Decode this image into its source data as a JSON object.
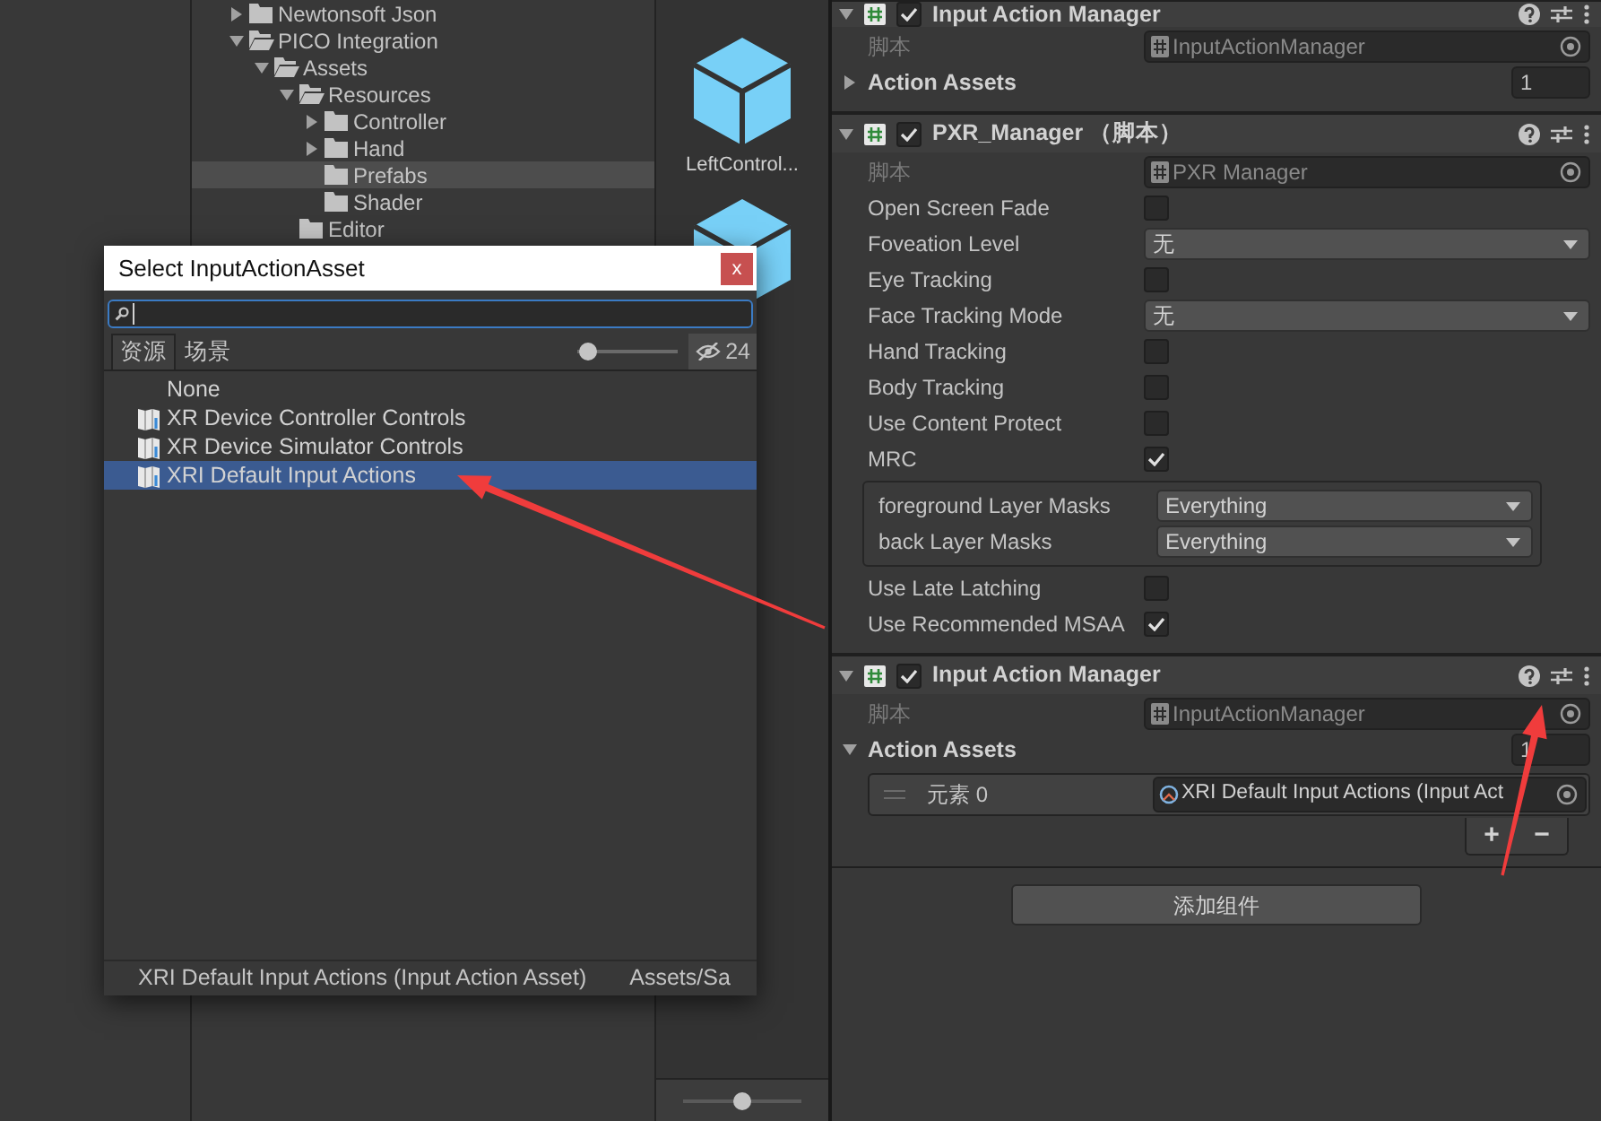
{
  "project_tree": [
    {
      "label": "Newtonsoft Json",
      "expanded": false,
      "selected": false
    },
    {
      "label": "PICO Integration",
      "expanded": true,
      "selected": false,
      "children": [
        {
          "label": "Assets",
          "expanded": true,
          "selected": false,
          "children": [
            {
              "label": "Resources",
              "expanded": true,
              "selected": false,
              "children": [
                {
                  "label": "Controller",
                  "expanded": false,
                  "selected": false
                },
                {
                  "label": "Hand",
                  "expanded": false,
                  "selected": false
                },
                {
                  "label": "Prefabs",
                  "selected": true
                },
                {
                  "label": "Shader",
                  "selected": false
                }
              ]
            },
            {
              "label": "Editor",
              "selected": false
            }
          ]
        }
      ]
    }
  ],
  "assets": [
    {
      "kind": "prefab",
      "label": "LeftControl..."
    },
    {
      "kind": "prefab"
    }
  ],
  "asset_zoom": {
    "level": 0.5
  },
  "picker": {
    "title": "Select InputActionAsset",
    "close": "x",
    "tabs": [
      {
        "label": "资源",
        "selected": true
      },
      {
        "label": "场景",
        "selected": false
      }
    ],
    "size_slider": {
      "level": 0.1
    },
    "hidden_count": "24",
    "items": [
      {
        "kind": "none",
        "label": "None",
        "selected": false
      },
      {
        "kind": "asset",
        "label": "XR Device Controller Controls",
        "selected": false
      },
      {
        "kind": "asset",
        "label": "XR Device Simulator Controls",
        "selected": false
      },
      {
        "kind": "asset",
        "label": "XRI Default Input Actions",
        "selected": true
      }
    ],
    "footer": {
      "name": "XRI Default Input Actions (Input Action Asset)",
      "path": "Assets/Sa"
    }
  },
  "inspector": {
    "components": [
      {
        "title": "Input Action Manager",
        "enabled": true,
        "expanded": true,
        "fields": [
          {
            "kind": "script",
            "label": "脚本",
            "value": "InputActionManager",
            "disabled": true
          },
          {
            "kind": "foldout",
            "label": "Action Assets",
            "expanded": false,
            "count": "1"
          }
        ]
      },
      {
        "title": "PXR_Manager （脚本）",
        "enabled": true,
        "expanded": true,
        "fields": [
          {
            "kind": "script",
            "label": "脚本",
            "value": "PXR Manager",
            "disabled": true
          },
          {
            "kind": "checkbox",
            "label": "Open Screen Fade",
            "checked": false
          },
          {
            "kind": "dropdown",
            "label": "Foveation Level",
            "value": "无"
          },
          {
            "kind": "checkbox",
            "label": "Eye Tracking",
            "checked": false
          },
          {
            "kind": "dropdown",
            "label": "Face Tracking Mode",
            "value": "无"
          },
          {
            "kind": "checkbox",
            "label": "Hand Tracking",
            "checked": false
          },
          {
            "kind": "checkbox",
            "label": "Body Tracking",
            "checked": false
          },
          {
            "kind": "checkbox",
            "label": "Use Content Protect",
            "checked": false
          },
          {
            "kind": "checkbox",
            "label": "MRC",
            "checked": true
          },
          {
            "kind": "group",
            "fields": [
              {
                "kind": "dropdown",
                "label": "foreground Layer Masks",
                "value": "Everything"
              },
              {
                "kind": "dropdown",
                "label": "back Layer Masks",
                "value": "Everything"
              }
            ]
          },
          {
            "kind": "checkbox",
            "label": "Use Late Latching",
            "checked": false
          },
          {
            "kind": "checkbox",
            "label": "Use Recommended MSAA",
            "checked": true
          }
        ]
      },
      {
        "title": "Input Action Manager",
        "enabled": true,
        "expanded": true,
        "fields": [
          {
            "kind": "script",
            "label": "脚本",
            "value": "InputActionManager",
            "disabled": true
          },
          {
            "kind": "foldout",
            "label": "Action Assets",
            "expanded": true,
            "count": "1"
          },
          {
            "kind": "element",
            "label": "元素 0",
            "value": "XRI Default Input Actions (Input Act"
          },
          {
            "kind": "list_buttons",
            "add": "+",
            "remove": "−"
          }
        ]
      }
    ],
    "add_component": "添加组件"
  },
  "annotations": [
    {
      "kind": "arrow"
    },
    {
      "kind": "arrow"
    }
  ]
}
